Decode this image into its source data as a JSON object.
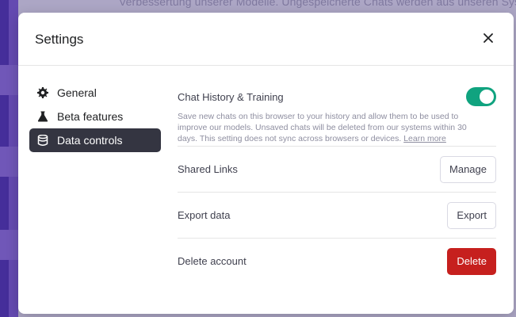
{
  "background": {
    "top_text": "Verbessertung unserer Modelle. Ungespeicherte Chats werden aus unseren Systemen gelöscht"
  },
  "modal": {
    "title": "Settings",
    "close_icon": "close-icon"
  },
  "sidebar": {
    "items": [
      {
        "label": "General",
        "icon": "gear-icon",
        "active": false
      },
      {
        "label": "Beta features",
        "icon": "flask-icon",
        "active": false
      },
      {
        "label": "Data controls",
        "icon": "database-icon",
        "active": true
      }
    ]
  },
  "content": {
    "chat_history": {
      "label": "Chat History & Training",
      "description": "Save new chats on this browser to your history and allow them to be used to improve our models. Unsaved chats will be deleted from our systems within 30 days. This setting does not sync across browsers or devices.",
      "link": "Learn more",
      "enabled": true
    },
    "shared_links": {
      "label": "Shared Links",
      "button": "Manage"
    },
    "export_data": {
      "label": "Export data",
      "button": "Export"
    },
    "delete_account": {
      "label": "Delete account",
      "button": "Delete"
    }
  },
  "colors": {
    "toggle_on": "#10a37f",
    "active_item": "#343541",
    "danger": "#c6201e"
  }
}
